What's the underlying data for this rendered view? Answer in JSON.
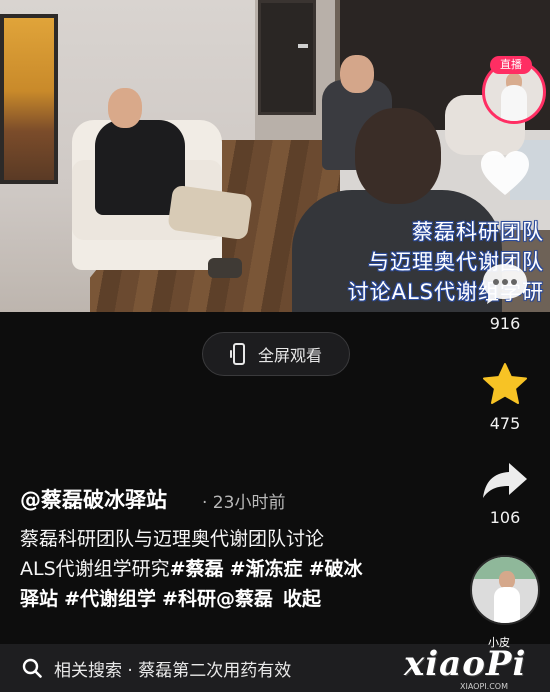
{
  "video": {
    "live_tag": "直播",
    "subtitle_lines": [
      "蔡磊科研团队",
      "与迈理奥代谢团队",
      "讨论ALS代谢组学研"
    ]
  },
  "fullscreen_button": {
    "label": "全屏观看"
  },
  "actions": {
    "like_count": "",
    "comment_count": "916",
    "favorite_count": "475",
    "share_count": "106"
  },
  "post": {
    "author": "@蔡磊破冰驿站",
    "time": "· 23小时前",
    "description_lines": [
      [
        {
          "t": "蔡磊科研团队与迈理奥代谢团队讨论",
          "tag": false
        }
      ],
      [
        {
          "t": "ALS代谢组学研究",
          "tag": false
        },
        {
          "t": "#蔡磊",
          "tag": true
        },
        {
          "t": " ",
          "tag": false
        },
        {
          "t": "#渐冻症",
          "tag": true
        },
        {
          "t": " ",
          "tag": false
        },
        {
          "t": "#破冰",
          "tag": true
        }
      ],
      [
        {
          "t": "驿站",
          "tag": true
        },
        {
          "t": " ",
          "tag": false
        },
        {
          "t": "#代谢组学",
          "tag": true
        },
        {
          "t": " ",
          "tag": false
        },
        {
          "t": "#科研@蔡磊",
          "tag": true
        }
      ]
    ],
    "collapse_label": "收起"
  },
  "search": {
    "text": "相关搜索 · 蔡磊第二次用药有效"
  },
  "watermark": {
    "small": "小皮",
    "big": "xiaoPi",
    "url": "XIAOPI.COM"
  }
}
